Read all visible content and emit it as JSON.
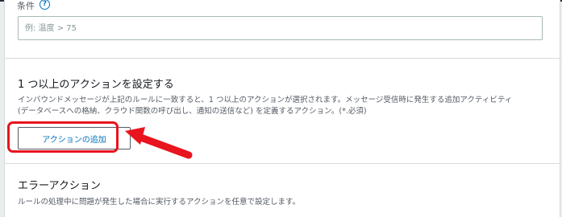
{
  "condition": {
    "label": "条件",
    "help_icon": "question-circle-icon",
    "placeholder": "例: 温度 > 75"
  },
  "actions_section": {
    "title": "1 つ以上のアクションを設定する",
    "description_line1": "インバウンドメッセージが上記のルールに一致すると、1 つ以上のアクションが選択されます。メッセージ受信時に発生する追加アクティビティ",
    "description_line2": "(データベースへの格納、クラウド関数の呼び出し、通知の送信など) を定義するアクション。(*.必須)",
    "add_button_label": "アクションの追加"
  },
  "error_section": {
    "title": "エラーアクション",
    "description": "ルールの処理中に問題が発生した場合に実行するアクションを任意で設定します。"
  },
  "annotation": {
    "highlight_color": "#e8141e",
    "arrow_icon": "left-arrow-icon"
  },
  "colors": {
    "link_blue": "#0073bb",
    "border_gray": "#aab7b8",
    "background": "#eaeded"
  }
}
